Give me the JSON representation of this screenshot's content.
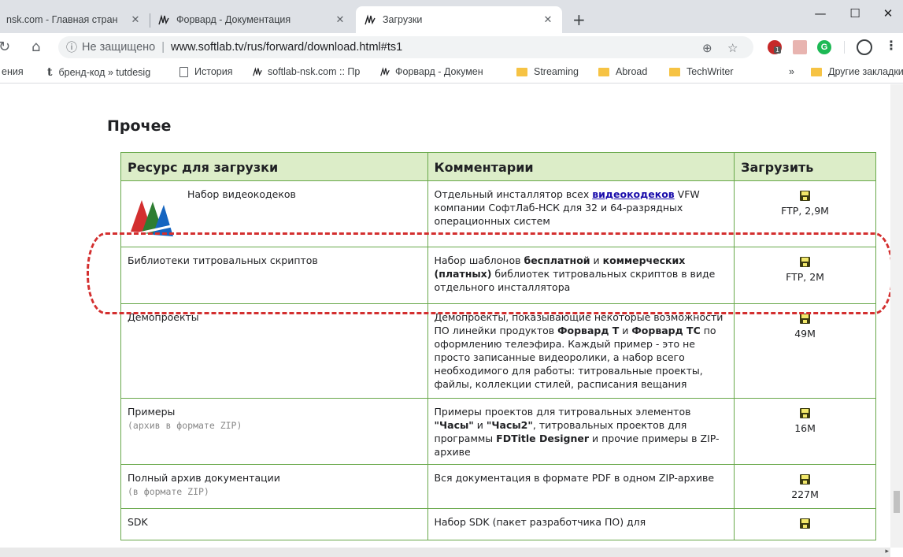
{
  "tabs": [
    {
      "label": "nsk.com - Главная стран",
      "active": false
    },
    {
      "label": "Форвард - Документация",
      "active": false
    },
    {
      "label": "Загрузки",
      "active": true
    }
  ],
  "toolbar": {
    "security_label": "Не защищено",
    "url": "www.softlab.tv/rus/forward/download.html#ts1",
    "abp_badge": "1"
  },
  "bookmarks": [
    "ения",
    "бренд-код » tutdesig",
    "История",
    "softlab-nsk.com :: Пр",
    "Форвард - Докумен",
    "Streaming",
    "Abroad",
    "TechWriter"
  ],
  "bookmarks_overflow": "»",
  "bookmarks_other": "Другие закладки",
  "page": {
    "section_title": "Прочее",
    "headers": [
      "Ресурс для загрузки",
      "Комментарии",
      "Загрузить"
    ],
    "rows": [
      {
        "name": "Набор видеокодеков",
        "sub": "",
        "comment_before": "Отдельный инсталлятор всех ",
        "comment_link": "видеокодеков",
        "comment_after": " VFW компании СофтЛаб-НСК для 32 и 64-разрядных операционных систем",
        "download": "FTP, 2,9M"
      },
      {
        "name": "Библиотеки титровальных скриптов",
        "sub": "",
        "comment_p1": "Набор шаблонов ",
        "comment_b1": "бесплатной",
        "comment_p2": " и ",
        "comment_b2": "коммерческих (платных)",
        "comment_p3": " библиотек титровальных скриптов в виде отдельного инсталлятора",
        "download": "FTP, 2M"
      },
      {
        "name": "Демопроекты",
        "sub": "",
        "comment_p1": "Демопроекты, показывающие некоторые возможности ПО линейки продуктов ",
        "comment_b1": "Форвард Т",
        "comment_p2": " и ",
        "comment_b2": "Форвард ТС",
        "comment_p3": " по оформлению телеэфира. Каждый пример - это не просто записанные видеоролики, а набор всего необходимого для работы: титровальные проекты, файлы, коллекции стилей, расписания вещания",
        "download": "49M"
      },
      {
        "name": "Примеры",
        "sub": "(архив в формате ZIP)",
        "comment_p1": "Примеры проектов для титровальных элементов ",
        "comment_b1": "\"Часы\"",
        "comment_p2": " и ",
        "comment_b2": "\"Часы2\"",
        "comment_p3": ", титровальных проектов для программы ",
        "comment_b3": "FDTitle Designer",
        "comment_p4": " и прочие примеры в ZIP-архиве",
        "download": "16M"
      },
      {
        "name": "Полный архив документации",
        "sub": "(в формате ZIP)",
        "comment": "Вся документация в формате PDF в одном ZIP-архиве",
        "download": "227M"
      },
      {
        "name": "SDK",
        "sub": "",
        "comment": "Набор SDK (пакет разработчика ПО) для",
        "download": ""
      }
    ]
  },
  "colors": {
    "table_border": "#68a84a",
    "header_bg": "#dcedc8",
    "highlight_dash": "#d32f2f",
    "link": "#1a0dab"
  }
}
